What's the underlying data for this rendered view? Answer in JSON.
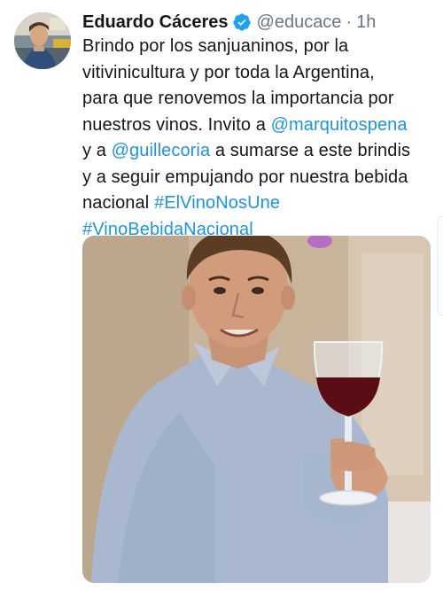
{
  "tweet": {
    "author": {
      "display_name": "Eduardo Cáceres",
      "handle": "@educace",
      "verified": true
    },
    "separator": "·",
    "time": "1h",
    "text": {
      "line1": "Brindo por los sanjuaninos, por la",
      "line2": "vitivinicultura y por toda la Argentina,",
      "line3": "para que renovemos la importancia por",
      "line4_prefix": "nuestros vinos. Invito a ",
      "mention1": "@marquitospena",
      "line5_prefix": "y a ",
      "mention2": "@guillecoria",
      "line5_suffix": " a sumarse a este brindis",
      "line6": "y a seguir empujando por nuestra bebida",
      "line7_prefix": "nacional  ",
      "hashtag1": "#ElVinoNosUne",
      "hashtag2": "#VinoBebidaNacional"
    },
    "media": {
      "type": "video-thumbnail",
      "description_icon": "video-media"
    }
  },
  "colors": {
    "link": "#1b95e0",
    "secondary_text": "#657786",
    "verified_badge": "#1da1f2",
    "wine": "#5a0d15"
  }
}
